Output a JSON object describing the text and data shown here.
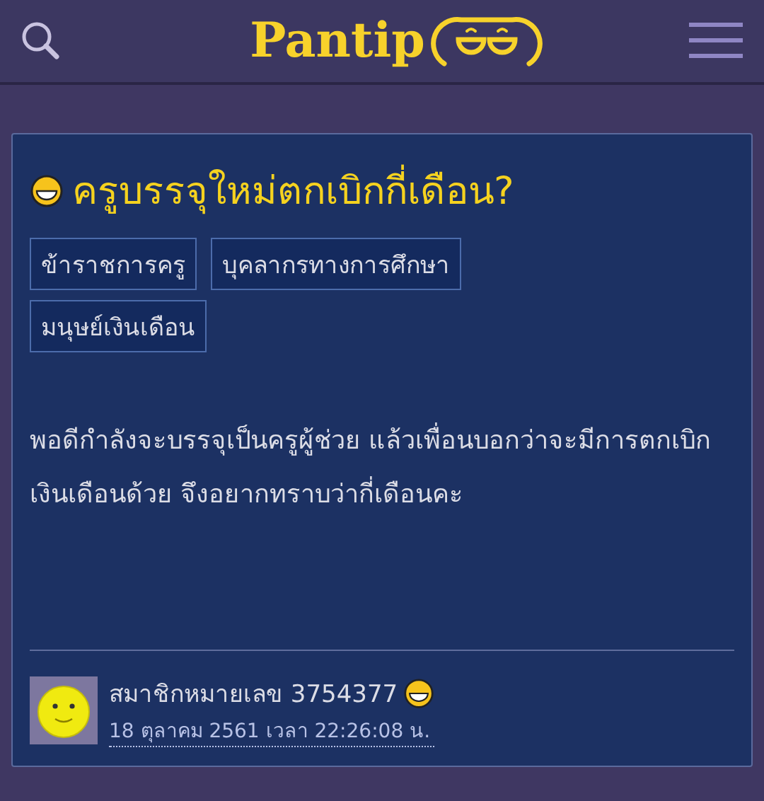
{
  "header": {
    "logo": "Pantip"
  },
  "topic": {
    "title": "ครูบรรจุใหม่ตกเบิกกี่เดือน?",
    "tags": [
      "ข้าราชการครู",
      "บุคลากรทางการศึกษา",
      "มนุษย์เงินเดือน"
    ],
    "body": "พอดีกำลังจะบรรจุเป็นครูผู้ช่วย แล้วเพื่อนบอกว่าจะมีการตกเบิกเงินเดือนด้วย จึงอยากทราบว่ากี่เดือนคะ",
    "author": "สมาชิกหมายเลข 3754377",
    "timestamp": "18 ตุลาคม 2561 เวลา 22:26:08 น."
  }
}
